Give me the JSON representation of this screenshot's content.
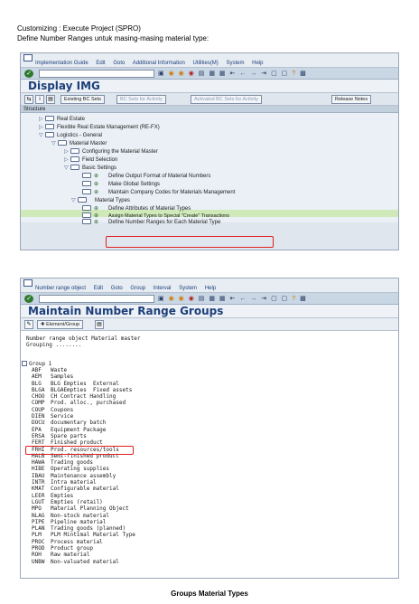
{
  "doc": {
    "line1": "Customizing : Execute Project (SPRO)",
    "line2": "Define Number Ranges untuk masing-masing material type:",
    "caption": "Groups Material Types"
  },
  "img_window": {
    "menu": [
      "Implementation Guide",
      "Edit",
      "Goto",
      "Additional Information",
      "Utilities(M)",
      "System",
      "Help"
    ],
    "title": "Display IMG",
    "buttons": {
      "existing_bc_sets": "Existing BC Sets",
      "bc_sets_for_activity": "BC Sets for Activity",
      "activated_bc_sets": "Activated BC Sets for Activity",
      "release_notes": "Release Notes"
    },
    "tree_header": "Structure",
    "tree": [
      {
        "label": "Real Estate"
      },
      {
        "label": "Flexible Real Estate Management (RE-FX)"
      },
      {
        "label": "Logistics - General"
      },
      {
        "label": "Material Master"
      },
      {
        "label": "Configuring the Material Master"
      },
      {
        "label": "Field Selection"
      },
      {
        "label": "Basic Settings"
      },
      {
        "label": "Define Output Format of Material Numbers"
      },
      {
        "label": "Make Global Settings"
      },
      {
        "label": "Maintain Company Codes for Materials Management"
      },
      {
        "label": "Material Types"
      },
      {
        "label": "Define Attributes of Material Types"
      },
      {
        "label": "Assign Material Types to Special \"Create\" Transactions"
      },
      {
        "label": "Define Number Ranges for Each Material Type"
      }
    ]
  },
  "nr_window": {
    "menu": [
      "Number range object",
      "Edit",
      "Goto",
      "Group",
      "Interval",
      "System",
      "Help"
    ],
    "title": "Maintain Number Range Groups",
    "element_group_button": "Element/Group",
    "header_line1": "Number range object Material master",
    "header_line2": "Grouping ........",
    "group_label": "Group 1",
    "rows": [
      {
        "code": "ABF",
        "text": "Waste"
      },
      {
        "code": "AEM",
        "text": "Samples"
      },
      {
        "code": "BLG",
        "text": "BLG Empties  External"
      },
      {
        "code": "BLGA",
        "text": "BLGAEmpties  Fixed assets"
      },
      {
        "code": "CHOO",
        "text": "CH Contract Handling"
      },
      {
        "code": "COMP",
        "text": "Prod. alloc., purchased"
      },
      {
        "code": "COUP",
        "text": "Coupons"
      },
      {
        "code": "DIEN",
        "text": "Service"
      },
      {
        "code": "DOCU",
        "text": "documentary batch"
      },
      {
        "code": "EPA",
        "text": "Equipment Package"
      },
      {
        "code": "ERSA",
        "text": "Spare parts"
      },
      {
        "code": "FERT",
        "text": "Finished product"
      },
      {
        "code": "FRHI",
        "text": "Prod. resources/tools"
      },
      {
        "code": "HALB",
        "text": "Semi-finished product"
      },
      {
        "code": "HAWA",
        "text": "Trading goods"
      },
      {
        "code": "HIBE",
        "text": "Operating supplies"
      },
      {
        "code": "IBAU",
        "text": "Maintenance assembly"
      },
      {
        "code": "INTR",
        "text": "Intra material"
      },
      {
        "code": "KMAT",
        "text": "Configurable material"
      },
      {
        "code": "LEER",
        "text": "Empties"
      },
      {
        "code": "LGUT",
        "text": "Empties (retail)"
      },
      {
        "code": "MPO",
        "text": "Material Planning Object"
      },
      {
        "code": "NLAG",
        "text": "Non-stock material"
      },
      {
        "code": "PIPE",
        "text": "Pipeline material"
      },
      {
        "code": "PLAN",
        "text": "Trading goods (planned)"
      },
      {
        "code": "PLM",
        "text": "PLM Mintimal Material Type"
      },
      {
        "code": "PROC",
        "text": "Process material"
      },
      {
        "code": "PROD",
        "text": "Product group"
      },
      {
        "code": "ROH",
        "text": "Raw material"
      },
      {
        "code": "UNBW",
        "text": "Non-valuated material"
      }
    ]
  },
  "colors": {
    "highlight_box": "#e02020",
    "title": "#1c3f7a",
    "selected_row": "#cfe9b8"
  }
}
